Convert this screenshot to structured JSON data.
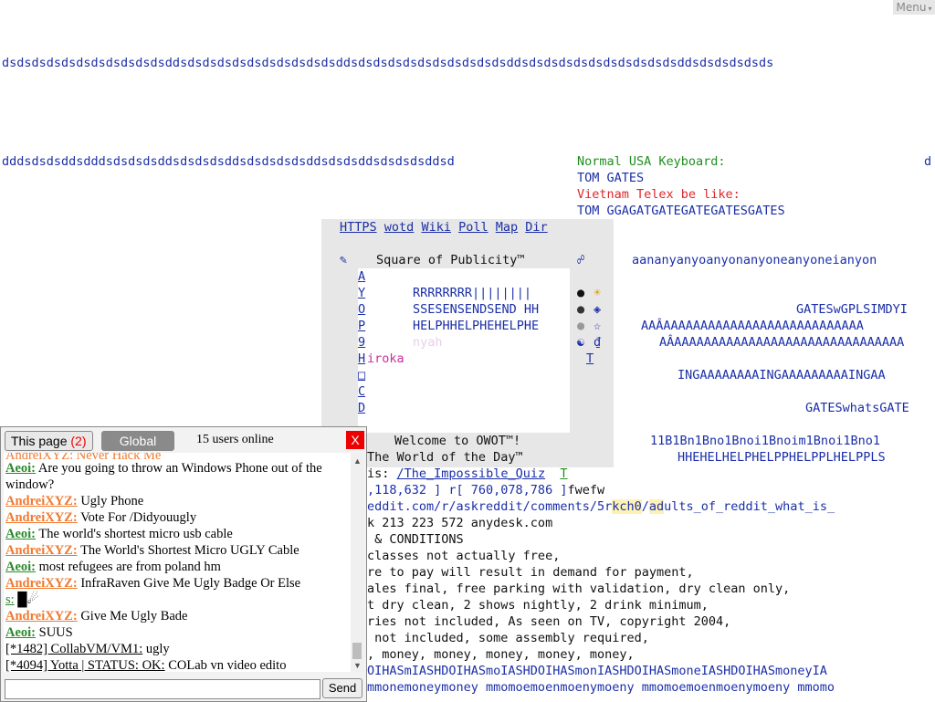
{
  "menu": {
    "label": "Menu"
  },
  "world": {
    "row1": "dsdsdsdsdsdsdsdsdsdsdsddsdsdsdsdsdsdsdsdsdsdsddsdsdsdsdsdsdsdsdsdsdsddsdsdsdsdsdsdsdsdsdsdsddsdsdsdsdsds",
    "row2": "dddsdsdsddsdddsdsdsdsddsdsdsdsddsdsdsdsdsddsdsdsddsdsdsdsddsd",
    "normal_label": "Normal USA Keyboard:",
    "normal_right": "d",
    "tom_gates": "TOM GATES",
    "vietnam": "Vietnam Telex be like:",
    "tom_telex": "TOM GGAGATGATEGATEGATESGATES",
    "nav_links": [
      "HTTPS",
      "wotd",
      "Wiki",
      "Poll",
      "Map",
      "Dir"
    ],
    "pencil_icon": "✎",
    "square_title": "Square of Publicity™",
    "link_icon": "☍",
    "right_line1": "aananyanyoanyonanyoneanyoneianyon",
    "left_letters": [
      "A",
      "Y",
      "O",
      "P",
      "9",
      "H",
      "□",
      "C",
      "D"
    ],
    "r_line": "RRRRRRRR||||||||",
    "s_line": "SSESENSENDSEND HH",
    "h_line": "HELPHHELPHEHELPHE",
    "nyah": "nyah",
    "hiroka": "iroka",
    "sym_col": [
      "●",
      "●",
      "●",
      "☯"
    ],
    "sym_col2": [
      "☀",
      "◈",
      "☆",
      "₫",
      "T"
    ],
    "gates_gpl": "GATESwGPLSIMDYI",
    "aaa1": "AAÂAAAAAAAAAAAAAAAAAAAAAAAAAAA",
    "aaa2": "AÂAAAAAAAAAAAAAAAAAAAAAAAAAAAAAAA",
    "inga": "INGAAAAAAAAINGAAAAAAAAAINGAA",
    "gates_whats": "GATESwhatsGATE",
    "welcome": "Welcome to OWOT™!",
    "b_line": "11B1Bn1Bno1Bnoi1Bnoim1Bnoi1Bno1",
    "wotd_line": "The World of the Day™",
    "hhe_line": "HHEHELHELPHELPPHELPPLHELPPLS",
    "is_label": "is:",
    "quiz_link": "/The_Impossible_Quiz",
    "quiz_t": "T",
    "coords_a": ",118,632 ] r[ 760,078,786 ]",
    "coords_b": "fwefw",
    "reddit_a": "eddit.com/r/askreddit/comments/5r",
    "reddit_hl1": "kch0",
    "reddit_b": "/",
    "reddit_hl2": "ad",
    "reddit_c": "ults_of_reddit_what_is_",
    "anydesk": "k 213 223 572 anydesk.com",
    "terms": [
      " & CONDITIONS",
      "classes not actually free,",
      "re to pay will result in demand for payment,",
      "ales final, free parking with validation, dry clean only,",
      "t dry clean, 2 shows nightly, 2 drink minimum,",
      "ries not included, As seen on TV, copyright 2004,",
      " not included, some assembly required,",
      ", money, money, money, money, money,"
    ],
    "money_blue1": "OIHASmIASHDOIHASmoIASHDOIHASmonIASHDOIHASmoneIASHDOIHASmoneyIA",
    "money_blue2": "mmonemoneymoney mmomoemoenmoenymoeny mmomoemoenmoenymoeny mmomo"
  },
  "chat": {
    "tab_this": "This page",
    "tab_this_count": "(2)",
    "tab_global": "Global",
    "users_online": "15 users online",
    "close": "X",
    "partial": "AndreiXYZ: Never Hack Me",
    "messages": [
      {
        "nick": "Aeoi:",
        "color": "green",
        "text": "Are you going to throw an Windows Phone out of the window?"
      },
      {
        "nick": "AndreiXYZ:",
        "color": "orange",
        "text": "Ugly Phone"
      },
      {
        "nick": "AndreiXYZ:",
        "color": "orange",
        "text": "Vote For /Didyouugly"
      },
      {
        "nick": "Aeoi:",
        "color": "green",
        "text": "The world's shortest micro usb cable"
      },
      {
        "nick": "AndreiXYZ:",
        "color": "orange",
        "text": "The World's Shortest Micro UGLY Cable"
      },
      {
        "nick": "Aeoi:",
        "color": "green",
        "text": "most refugees are from poland hm"
      },
      {
        "nick": "AndreiXYZ:",
        "color": "orange",
        "text": "InfraRaven Give Me Ugly Badge Or Else"
      },
      {
        "nick": "s:",
        "color": "green",
        "text": "█☄"
      },
      {
        "nick": "AndreiXYZ:",
        "color": "orange",
        "text": "Give Me Ugly Bade"
      },
      {
        "nick": "Aeoi:",
        "color": "green",
        "text": "SUUS"
      },
      {
        "nick": "[*1482] CollabVM/VM1:",
        "color": "sys",
        "text": "ugly"
      },
      {
        "nick": "[*4094] Yotta | STATUS: OK:",
        "color": "sys",
        "text": "COLab vn video edito"
      }
    ],
    "send": "Send",
    "input_value": ""
  }
}
